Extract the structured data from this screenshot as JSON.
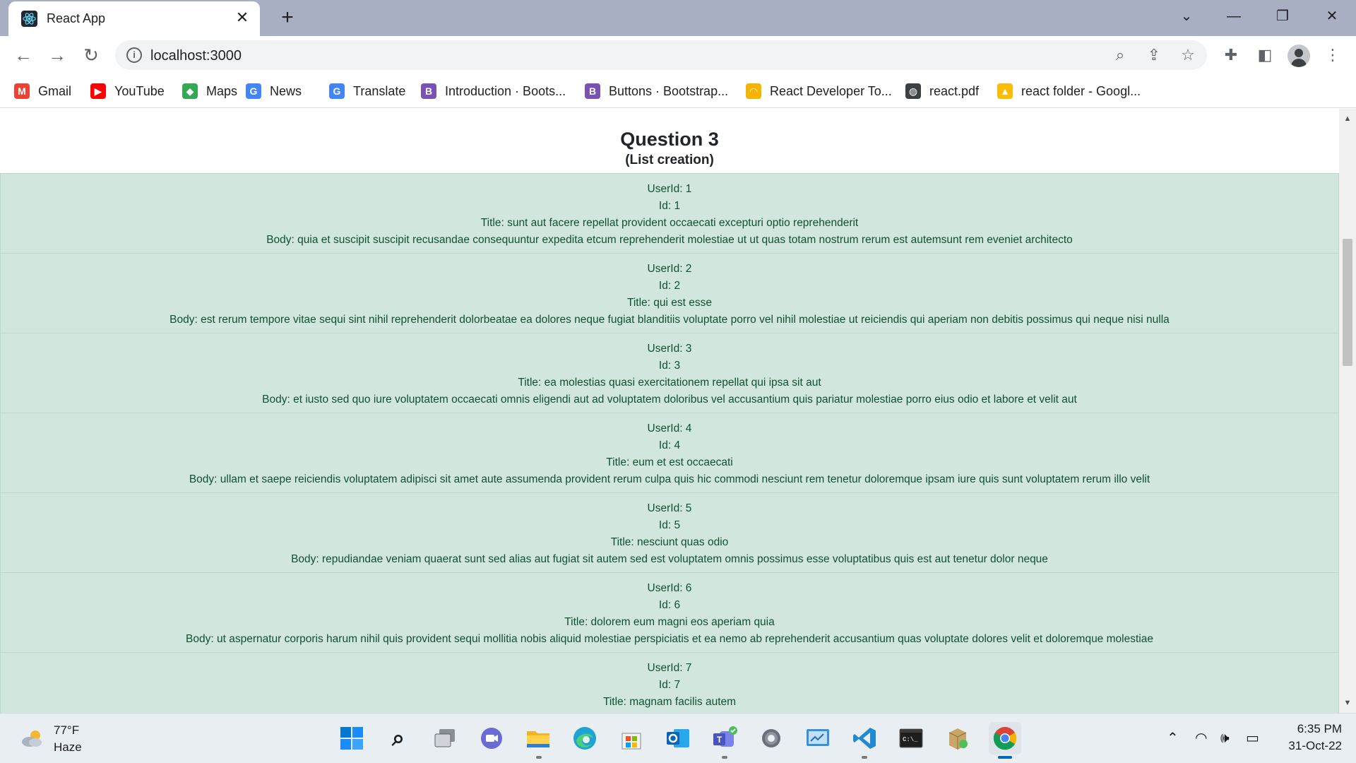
{
  "browser": {
    "tab_title": "React App",
    "tab_close_glyph": "✕",
    "new_tab_glyph": "+",
    "url": "localhost:3000",
    "info_glyph": "i"
  },
  "bookmarks": [
    {
      "label": "Gmail",
      "icon": "gmail-icon",
      "color": "#ea4335",
      "glyph": "M"
    },
    {
      "label": "YouTube",
      "icon": "youtube-icon",
      "color": "#ff0000",
      "glyph": "▶"
    },
    {
      "label": "Maps",
      "icon": "maps-icon",
      "color": "#34a853",
      "glyph": "◆"
    },
    {
      "label": "News",
      "icon": "news-icon",
      "color": "#4285f4",
      "glyph": "G"
    },
    {
      "label": "Translate",
      "icon": "translate-icon",
      "color": "#4285f4",
      "glyph": "G"
    },
    {
      "label": "Introduction · Boots...",
      "icon": "bootstrap-icon",
      "color": "#7952b3",
      "glyph": "B"
    },
    {
      "label": "Buttons · Bootstrap...",
      "icon": "bootstrap-icon",
      "color": "#7952b3",
      "glyph": "B"
    },
    {
      "label": "React Developer To...",
      "icon": "chrome-webstore-icon",
      "color": "#f4b400",
      "glyph": "◠"
    },
    {
      "label": "react.pdf",
      "icon": "globe-icon",
      "color": "#3c4043",
      "glyph": "◍"
    },
    {
      "label": "react folder - Googl...",
      "icon": "google-drive-icon",
      "color": "#fbbc04",
      "glyph": "▲"
    }
  ],
  "page": {
    "title": "Question 3",
    "subtitle": "(List creation)"
  },
  "posts": [
    {
      "userId": "UserId: 1",
      "id": "Id: 1",
      "title": "Title: sunt aut facere repellat provident occaecati excepturi optio reprehenderit",
      "body": "Body: quia et suscipit suscipit recusandae consequuntur expedita etcum reprehenderit molestiae ut ut quas totam nostrum rerum est autemsunt rem eveniet architecto"
    },
    {
      "userId": "UserId: 2",
      "id": "Id: 2",
      "title": "Title: qui est esse",
      "body": "Body: est rerum tempore vitae sequi sint nihil reprehenderit dolorbeatae ea dolores neque fugiat blanditiis voluptate porro vel nihil molestiae ut reiciendis qui aperiam non debitis possimus qui neque nisi nulla"
    },
    {
      "userId": "UserId: 3",
      "id": "Id: 3",
      "title": "Title: ea molestias quasi exercitationem repellat qui ipsa sit aut",
      "body": "Body: et iusto sed quo iure voluptatem occaecati omnis eligendi aut ad voluptatem doloribus vel accusantium quis pariatur molestiae porro eius odio et labore et velit aut"
    },
    {
      "userId": "UserId: 4",
      "id": "Id: 4",
      "title": "Title: eum et est occaecati",
      "body": "Body: ullam et saepe reiciendis voluptatem adipisci sit amet aute assumenda provident rerum culpa quis hic commodi nesciunt rem tenetur doloremque ipsam iure quis sunt voluptatem rerum illo velit"
    },
    {
      "userId": "UserId: 5",
      "id": "Id: 5",
      "title": "Title: nesciunt quas odio",
      "body": "Body: repudiandae veniam quaerat sunt sed alias aut fugiat sit autem sed est voluptatem omnis possimus esse voluptatibus quis est aut tenetur dolor neque"
    },
    {
      "userId": "UserId: 6",
      "id": "Id: 6",
      "title": "Title: dolorem eum magni eos aperiam quia",
      "body": "Body: ut aspernatur corporis harum nihil quis provident sequi mollitia nobis aliquid molestiae perspiciatis et ea nemo ab reprehenderit accusantium quas voluptate dolores velit et doloremque molestiae"
    },
    {
      "userId": "UserId: 7",
      "id": "Id: 7",
      "title": "Title: magnam facilis autem",
      "body": ""
    }
  ],
  "taskbar": {
    "weather_temp": "77°F",
    "weather_desc": "Haze",
    "time": "6:35 PM",
    "date": "31-Oct-22",
    "apps": [
      {
        "name": "windows-start-icon"
      },
      {
        "name": "search-icon"
      },
      {
        "name": "task-view-icon"
      },
      {
        "name": "chat-icon"
      },
      {
        "name": "file-explorer-icon"
      },
      {
        "name": "edge-icon"
      },
      {
        "name": "microsoft-store-icon"
      },
      {
        "name": "outlook-icon"
      },
      {
        "name": "teams-icon"
      },
      {
        "name": "settings-icon"
      },
      {
        "name": "control-panel-icon"
      },
      {
        "name": "vscode-icon"
      },
      {
        "name": "terminal-icon"
      },
      {
        "name": "winrar-icon"
      },
      {
        "name": "chrome-icon"
      }
    ]
  },
  "colors": {
    "list_bg": "#d1e7dd",
    "list_text": "#0f5132",
    "list_border": "#badbcc"
  }
}
